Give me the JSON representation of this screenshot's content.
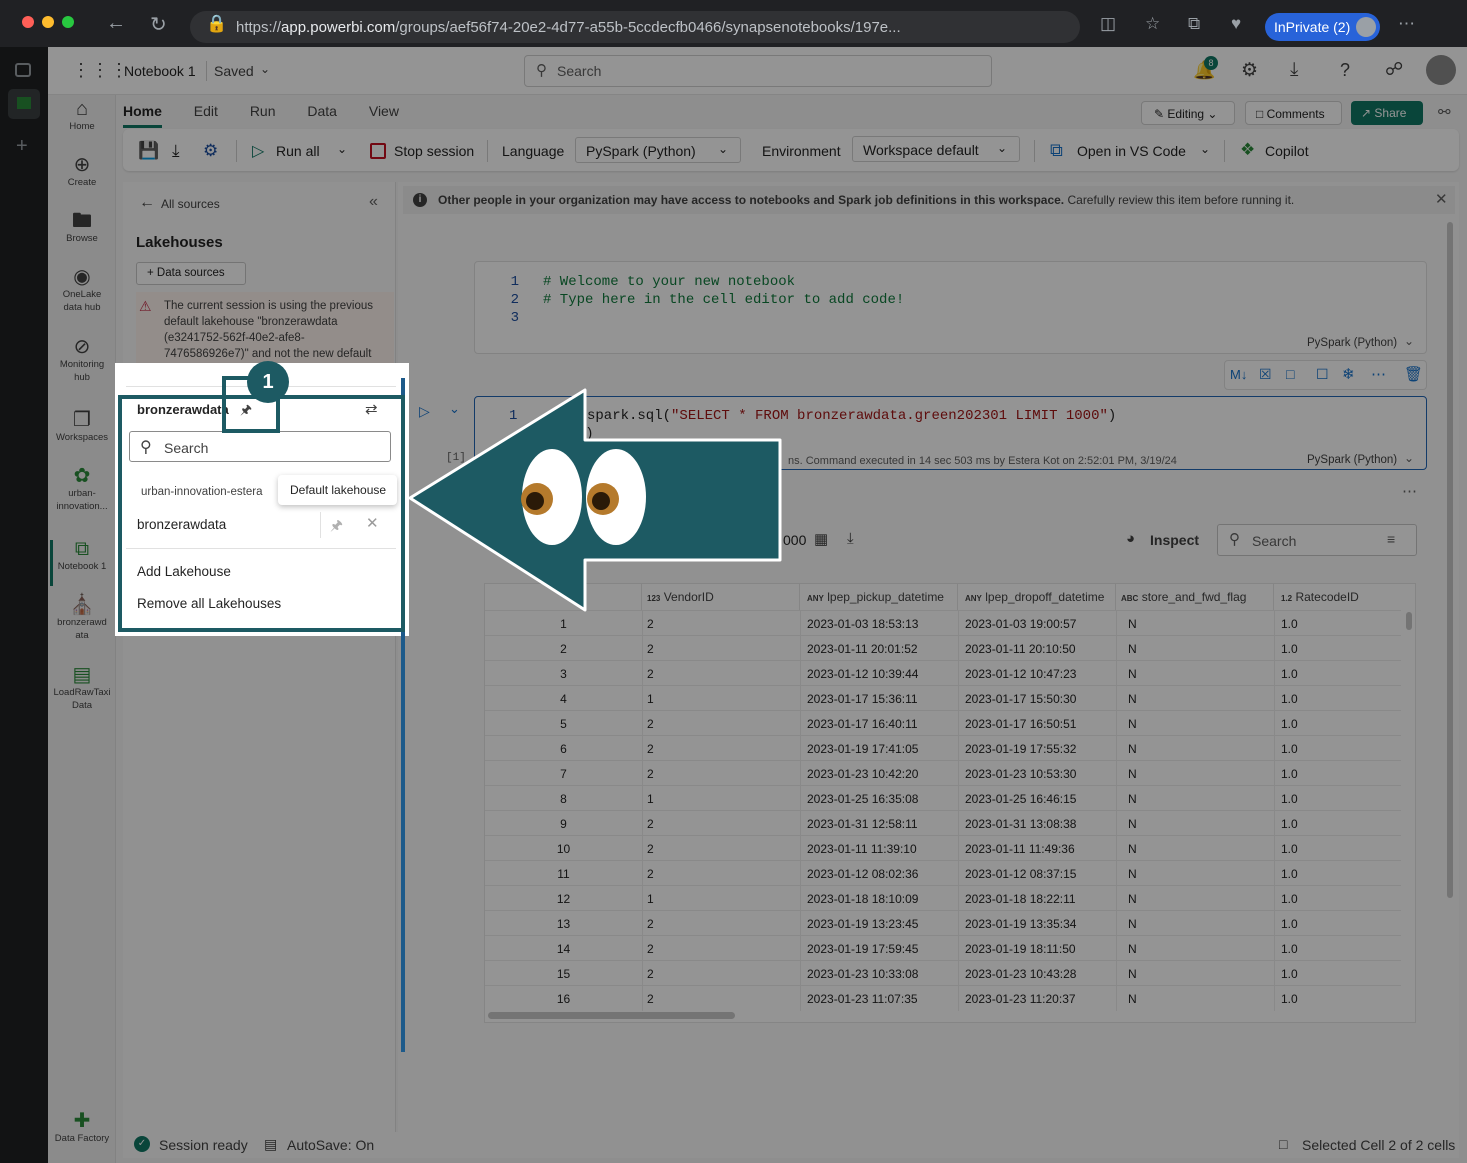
{
  "browser": {
    "url_prefix": "https://",
    "url_domain": "app.powerbi.com",
    "url_path": "/groups/aef56f74-20e2-4d77-a55b-5ccdecfb0466/synapsenotebooks/197e...",
    "inprivate_label": "InPrivate (2)"
  },
  "header": {
    "notebook_title": "Notebook 1",
    "save_state": "Saved",
    "search_placeholder": "Search",
    "notification_count": "8"
  },
  "leftnav": {
    "items": [
      {
        "label": "Home",
        "icon": "home-icon"
      },
      {
        "label": "Create",
        "icon": "plus-circle-icon"
      },
      {
        "label": "Browse",
        "icon": "folder-icon"
      },
      {
        "label": "OneLake data hub",
        "icon": "onelake-icon"
      },
      {
        "label": "Monitoring hub",
        "icon": "monitor-icon"
      },
      {
        "label": "Workspaces",
        "icon": "workspaces-icon"
      },
      {
        "label": "urban-innovation...",
        "icon": "people-icon"
      },
      {
        "label": "Notebook 1",
        "icon": "notebook-icon"
      },
      {
        "label": "bronzerawd ata",
        "icon": "lakehouse-icon"
      },
      {
        "label": "LoadRawTaxi Data",
        "icon": "pipeline-icon"
      },
      {
        "label": "Data Factory",
        "icon": "data-factory-icon"
      }
    ]
  },
  "ribbon": {
    "tabs": [
      "Home",
      "Edit",
      "Run",
      "Data",
      "View"
    ],
    "editing_label": "Editing",
    "comments_label": "Comments",
    "share_label": "Share",
    "run_all": "Run all",
    "stop_session": "Stop session",
    "language_label": "Language",
    "language_value": "PySpark (Python)",
    "environment_label": "Environment",
    "environment_value": "Workspace default",
    "vscode_label": "Open in VS Code",
    "copilot_label": "Copilot"
  },
  "explorer": {
    "back_label": "All sources",
    "section_title": "Lakehouses",
    "data_sources_btn": "Data sources",
    "warning": "The current session is using the previous default lakehouse \"bronzerawdata (e3241752-562f-40e2-afe8-7476586926e7)\" and not the new default for this notebook."
  },
  "popup": {
    "lakehouse_name": "bronzerawdata",
    "search_placeholder": "Search",
    "workspace_name": "urban-innovation-estera",
    "item_name": "bronzerawdata",
    "tooltip": "Default lakehouse",
    "add_lakehouse": "Add Lakehouse",
    "remove_all": "Remove all Lakehouses",
    "badge": "1"
  },
  "notebook": {
    "info_bold": "Other people in your organization may have access to notebooks and Spark job definitions in this workspace.",
    "info_rest": " Carefully review this item before running it.",
    "cell1": {
      "lines": [
        "# Welcome to your new notebook",
        "# Type here in the cell editor to add code!",
        ""
      ],
      "line_numbers": [
        "1",
        "2",
        "3"
      ],
      "language": "PySpark (Python)"
    },
    "cell2": {
      "line_number": "1",
      "code_visible_start": "spark.sql(",
      "code_string": "\"SELECT * FROM bronzerawdata.green202301 LIMIT 1000\"",
      "code_end": ")",
      "code_line2": "(df)",
      "exec_count": "[1]",
      "exec_status": "ns. Command executed in 14 sec 503 ms by Estera Kot on 2:52:01 PM, 3/19/24",
      "language": "PySpark (Python)"
    },
    "output": {
      "rows_fragment": "000",
      "inspect_label": "Inspect",
      "search_placeholder": "Search"
    }
  },
  "table": {
    "headers": [
      {
        "type": "",
        "name": ""
      },
      {
        "type": "123",
        "name": "VendorID"
      },
      {
        "type": "ANY",
        "name": "lpep_pickup_datetime"
      },
      {
        "type": "ANY",
        "name": "lpep_dropoff_datetime"
      },
      {
        "type": "ABC",
        "name": "store_and_fwd_flag"
      },
      {
        "type": "1.2",
        "name": "RatecodeID"
      }
    ],
    "rows": [
      [
        "1",
        "2",
        "2023-01-03 18:53:13",
        "2023-01-03 19:00:57",
        "N",
        "1.0"
      ],
      [
        "2",
        "2",
        "2023-01-11 20:01:52",
        "2023-01-11 20:10:50",
        "N",
        "1.0"
      ],
      [
        "3",
        "2",
        "2023-01-12 10:39:44",
        "2023-01-12 10:47:23",
        "N",
        "1.0"
      ],
      [
        "4",
        "1",
        "2023-01-17 15:36:11",
        "2023-01-17 15:50:30",
        "N",
        "1.0"
      ],
      [
        "5",
        "2",
        "2023-01-17 16:40:11",
        "2023-01-17 16:50:51",
        "N",
        "1.0"
      ],
      [
        "6",
        "2",
        "2023-01-19 17:41:05",
        "2023-01-19 17:55:32",
        "N",
        "1.0"
      ],
      [
        "7",
        "2",
        "2023-01-23 10:42:20",
        "2023-01-23 10:53:30",
        "N",
        "1.0"
      ],
      [
        "8",
        "1",
        "2023-01-25 16:35:08",
        "2023-01-25 16:46:15",
        "N",
        "1.0"
      ],
      [
        "9",
        "2",
        "2023-01-31 12:58:11",
        "2023-01-31 13:08:38",
        "N",
        "1.0"
      ],
      [
        "10",
        "2",
        "2023-01-11 11:39:10",
        "2023-01-11 11:49:36",
        "N",
        "1.0"
      ],
      [
        "11",
        "2",
        "2023-01-12 08:02:36",
        "2023-01-12 08:37:15",
        "N",
        "1.0"
      ],
      [
        "12",
        "1",
        "2023-01-18 18:10:09",
        "2023-01-18 18:22:11",
        "N",
        "1.0"
      ],
      [
        "13",
        "2",
        "2023-01-19 13:23:45",
        "2023-01-19 13:35:34",
        "N",
        "1.0"
      ],
      [
        "14",
        "2",
        "2023-01-19 17:59:45",
        "2023-01-19 18:11:50",
        "N",
        "1.0"
      ],
      [
        "15",
        "2",
        "2023-01-23 10:33:08",
        "2023-01-23 10:43:28",
        "N",
        "1.0"
      ],
      [
        "16",
        "2",
        "2023-01-23 11:07:35",
        "2023-01-23 11:20:37",
        "N",
        "1.0"
      ]
    ]
  },
  "status": {
    "session": "Session ready",
    "autosave": "AutoSave: On",
    "selected": "Selected Cell 2 of 2 cells"
  },
  "colors": {
    "accent": "#117865",
    "annotation": "#1d5a63",
    "warning_bg": "#fdf3ee"
  }
}
